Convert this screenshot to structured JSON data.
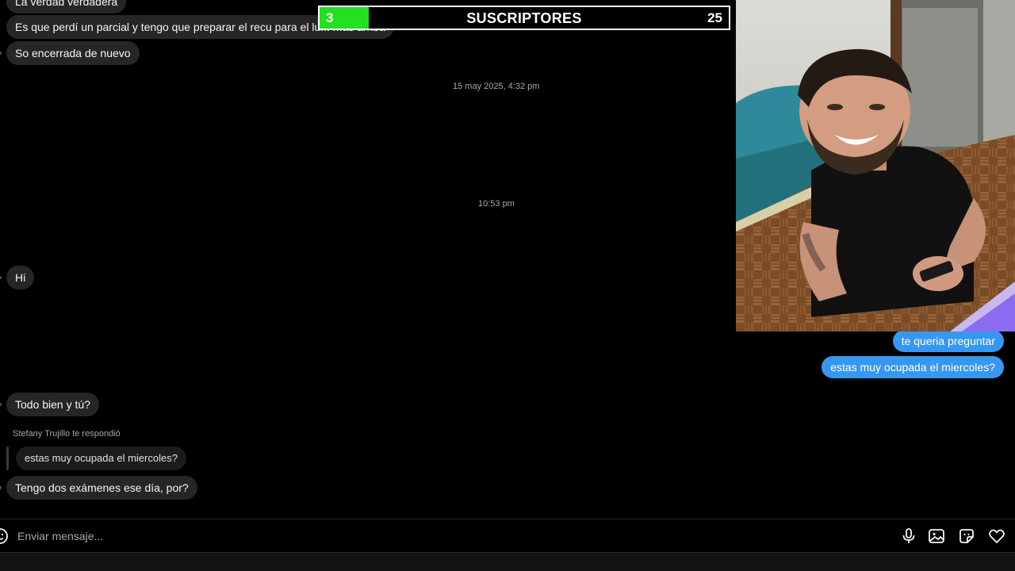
{
  "overlay": {
    "current_count": "3",
    "title": "SUSCRIPTORES",
    "goal_count": "25",
    "progress_fraction": 0.12,
    "fill_color": "#22e022"
  },
  "messages": {
    "m1": "La verdad verdadera",
    "m2": "Es que perdí un parcial y tengo que preparar el recu para el lu... más arriba",
    "m3": "So encerrada de nuevo",
    "ts1": "15 may 2025, 4:32 pm",
    "ts2": "10:53 pm",
    "m4": "Hi",
    "m5": "Todo bien y tú?",
    "reply_label": "Stefany Trujillo te respondió",
    "reply_quote": "estas muy ocupada el miercoles?",
    "m6": "Tengo dos exámenes ese día, por?"
  },
  "outgoing": {
    "o1": "te queria preguntar",
    "o2": "estas muy ocupada el miercoles?",
    "color": "#3797f0"
  },
  "composer": {
    "placeholder": "Enviar mensaje...",
    "icons": [
      "emoji-icon",
      "microphone-icon",
      "image-icon",
      "sticker-icon",
      "heart-icon"
    ]
  },
  "webcam": {
    "description_icon": "webcam-feed"
  }
}
